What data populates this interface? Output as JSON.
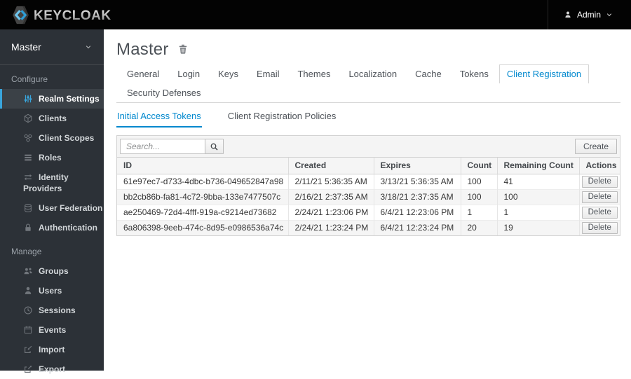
{
  "topbar": {
    "brand": "KEYCLOAK",
    "user_label": "Admin"
  },
  "sidebar": {
    "realm_selector": "Master",
    "sections": [
      {
        "label": "Configure",
        "items": [
          {
            "label": "Realm Settings",
            "icon": "sliders",
            "active": true
          },
          {
            "label": "Clients",
            "icon": "cube",
            "active": false
          },
          {
            "label": "Client Scopes",
            "icon": "circles",
            "active": false
          },
          {
            "label": "Roles",
            "icon": "roles",
            "active": false
          },
          {
            "label": "Identity Providers",
            "icon": "exchange",
            "active": false
          },
          {
            "label": "User Federation",
            "icon": "database",
            "active": false
          },
          {
            "label": "Authentication",
            "icon": "lock",
            "active": false
          }
        ]
      },
      {
        "label": "Manage",
        "items": [
          {
            "label": "Groups",
            "icon": "group",
            "active": false
          },
          {
            "label": "Users",
            "icon": "user",
            "active": false
          },
          {
            "label": "Sessions",
            "icon": "clock",
            "active": false
          },
          {
            "label": "Events",
            "icon": "calendar",
            "active": false
          },
          {
            "label": "Import",
            "icon": "import",
            "active": false
          },
          {
            "label": "Export",
            "icon": "export",
            "active": false
          }
        ]
      }
    ]
  },
  "main": {
    "title": "Master",
    "tabs": [
      "General",
      "Login",
      "Keys",
      "Email",
      "Themes",
      "Localization",
      "Cache",
      "Tokens",
      "Client Registration",
      "Security Defenses"
    ],
    "active_tab": "Client Registration",
    "subtabs": [
      "Initial Access Tokens",
      "Client Registration Policies"
    ],
    "active_subtab": "Initial Access Tokens",
    "toolbar": {
      "search_placeholder": "Search...",
      "create_label": "Create"
    },
    "table": {
      "columns": [
        "ID",
        "Created",
        "Expires",
        "Count",
        "Remaining Count",
        "Actions"
      ],
      "rows": [
        {
          "id": "61e97ec7-d733-4dbc-b736-049652847a98",
          "created": "2/11/21 5:36:35 AM",
          "expires": "3/13/21 5:36:35 AM",
          "count": "100",
          "remaining": "41",
          "action": "Delete"
        },
        {
          "id": "bb2cb86b-fa81-4c72-9bba-133e7477507c",
          "created": "2/16/21 2:37:35 AM",
          "expires": "3/18/21 2:37:35 AM",
          "count": "100",
          "remaining": "100",
          "action": "Delete"
        },
        {
          "id": "ae250469-72d4-4fff-919a-c9214ed73682",
          "created": "2/24/21 1:23:06 PM",
          "expires": "6/4/21 12:23:06 PM",
          "count": "1",
          "remaining": "1",
          "action": "Delete"
        },
        {
          "id": "6a806398-9eeb-474c-8d95-e0986536a74c",
          "created": "2/24/21 1:23:24 PM",
          "expires": "6/4/21 12:23:24 PM",
          "count": "20",
          "remaining": "19",
          "action": "Delete"
        }
      ]
    }
  },
  "colors": {
    "accent_blue": "#0088ce",
    "nav_active_border": "#39a5dc",
    "topbar_bg": "#030303",
    "sidebar_bg": "#2c3137",
    "logo_bracket_left": "#6ec6ee",
    "logo_bracket_right": "#2e9fd9"
  }
}
